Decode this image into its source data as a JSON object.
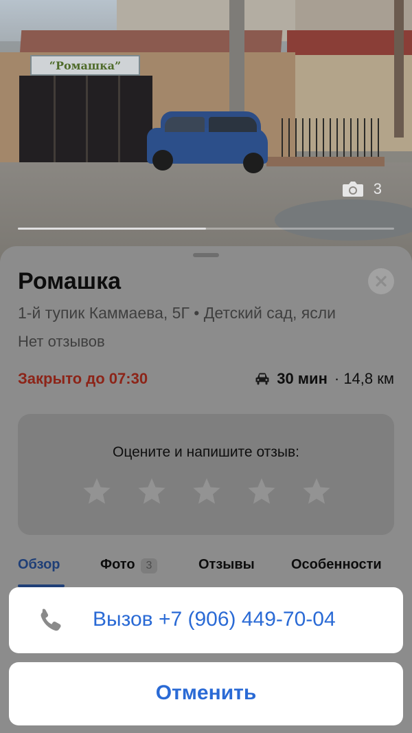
{
  "photo": {
    "sign_text": "“Ромашка”",
    "photo_count": "3",
    "gallery_progress": 0.5
  },
  "place": {
    "title": "Ромашка",
    "subtitle": "1-й тупик Каммаева, 5Г • Детский сад, ясли",
    "reviews": "Нет отзывов",
    "status": "Закрыто до 07:30",
    "travel_time": "30 мин",
    "distance": "· 14,8 км",
    "travel_icon": "car-icon"
  },
  "rating": {
    "prompt": "Оцените и напишите отзыв:",
    "stars": 5,
    "selected": 0
  },
  "tabs": [
    {
      "label": "Обзор",
      "active": true
    },
    {
      "label": "Фото",
      "badge": "3"
    },
    {
      "label": "Отзывы"
    },
    {
      "label": "Особенности"
    }
  ],
  "action_sheet": {
    "call_label": "Вызов +7 (906) 449-70-04",
    "cancel_label": "Отменить"
  },
  "colors": {
    "accent": "#2a6ad5",
    "closed": "#8c2418",
    "active_tab": "#1f3f77"
  }
}
